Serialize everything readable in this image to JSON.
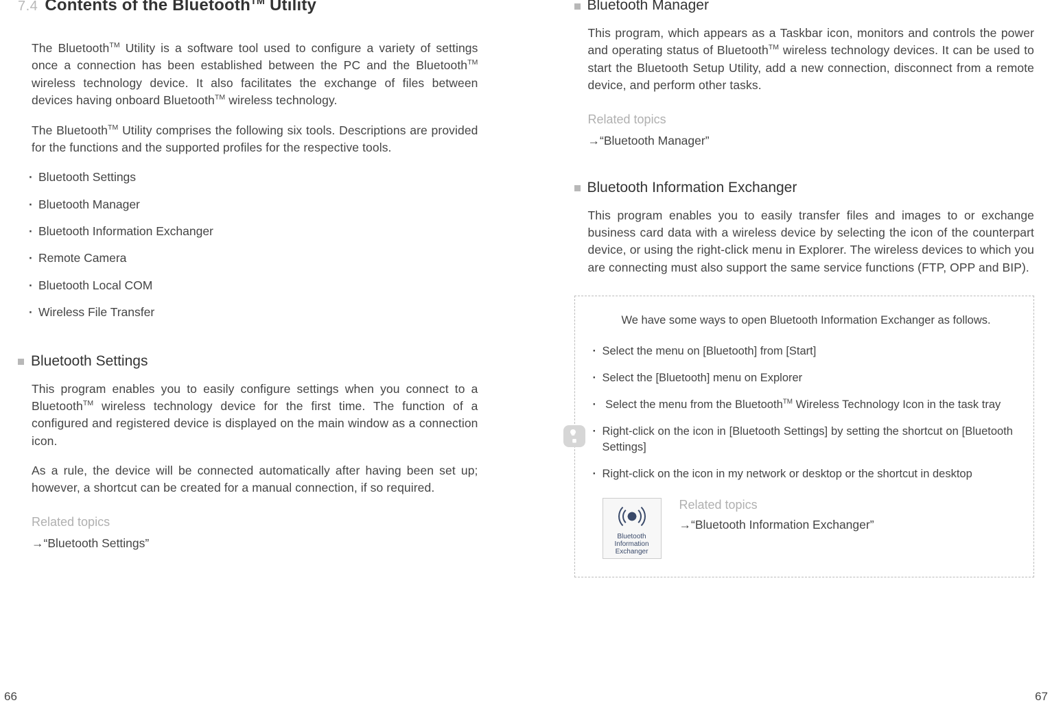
{
  "left": {
    "section_num": "7.4",
    "title_parts": [
      "Contents of the Bluetooth",
      "TM",
      " Utility"
    ],
    "para1_parts": [
      "The Bluetooth",
      "TM",
      " Utility is a software tool used to configure a variety of settings once a connection has been established between the PC and the Bluetooth",
      "TM",
      " wireless technology device. It also facilitates the exchange of files between devices having onboard Bluetooth",
      "TM",
      " wireless technology."
    ],
    "para2_parts": [
      "The Bluetooth",
      "TM",
      " Utility comprises the following six tools. Descriptions are provided for the functions and the supported profiles for the respective tools."
    ],
    "tools": [
      "Bluetooth Settings",
      "Bluetooth Manager",
      "Bluetooth Information Exchanger",
      "Remote Camera",
      "Bluetooth Local COM",
      "Wireless File Transfer"
    ],
    "sub1_title": "Bluetooth Settings",
    "sub1_para1_parts": [
      "This program enables you to easily configure settings when you connect to a Bluetooth",
      "TM",
      " wireless technology device for the first time. The function of a configured and registered device is displayed on the main window as a connection icon."
    ],
    "sub1_para2": "As a rule, the device will be connected automatically after having been set up; however, a shortcut can be created for a manual connection, if so required.",
    "related_label": "Related topics",
    "related_link": "→“Bluetooth Settings”",
    "page_num": "66"
  },
  "right": {
    "sub1_title": "Bluetooth Manager",
    "sub1_para_parts": [
      "This program, which appears as a Taskbar icon, monitors and controls the power and operating status of Bluetooth",
      "TM",
      " wireless technology devices. It can be used to start the Bluetooth Setup Utility, add a new connection, disconnect from a remote device, and perform other tasks."
    ],
    "related_label": "Related topics",
    "sub1_related": "→“Bluetooth Manager”",
    "sub2_title": "Bluetooth Information Exchanger",
    "sub2_para": "This program enables you to easily transfer files and images to or exchange business card data with a wireless device by selecting the icon of the counterpart device, or using the right-click menu in Explorer. The wireless devices to which you are connecting must also support the same service functions (FTP, OPP and BIP).",
    "note_intro": "We have some ways to open Bluetooth Information Exchanger as follows.",
    "note_items": [
      "Select the menu on [Bluetooth] from [Start]",
      "Select the [Bluetooth] menu on Explorer",
      {
        "parts": [
          "Select the menu from the Bluetooth",
          "TM",
          " Wireless Technology Icon in the task tray"
        ]
      },
      "Right-click on the icon in [Bluetooth Settings] by setting the shortcut on [Bluetooth Settings]",
      "Right-click on the icon in my network or desktop or the shortcut in desktop"
    ],
    "app_icon_label": "Bluetooth Information Exchanger",
    "note_related": "→“Bluetooth Information Exchanger”",
    "page_num": "67"
  }
}
